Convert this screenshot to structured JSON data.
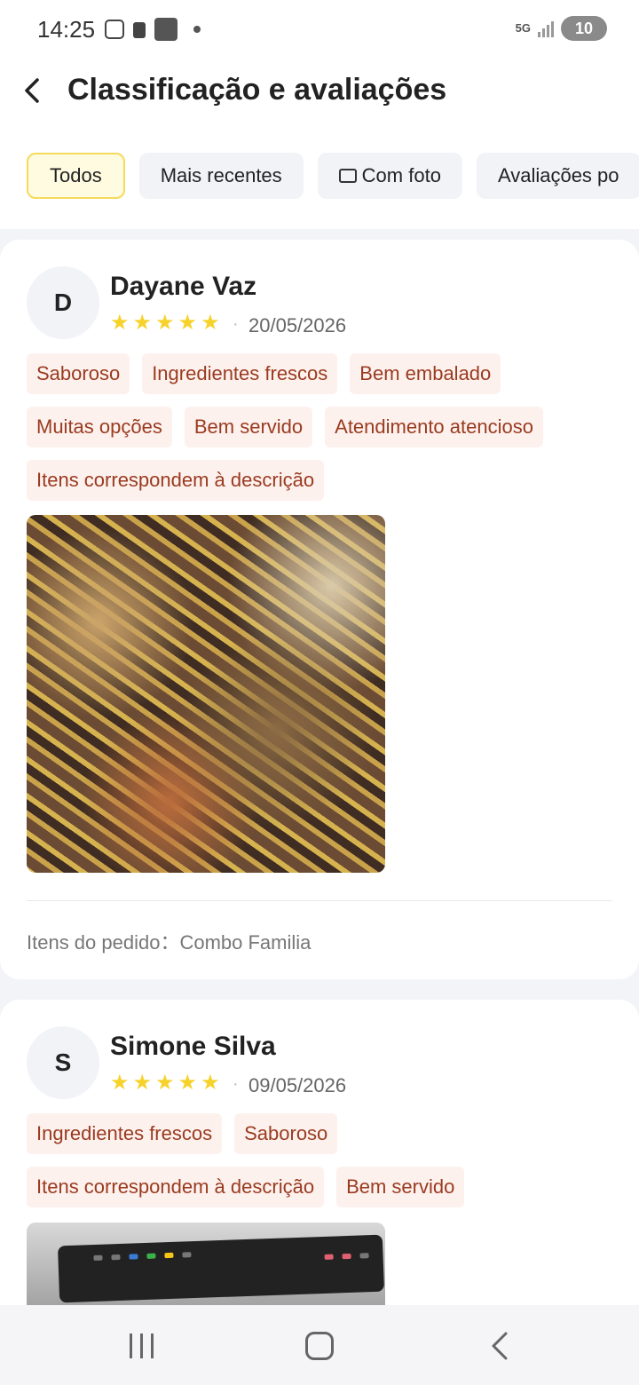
{
  "status_bar": {
    "time": "14:25",
    "network": "5G",
    "battery": "10"
  },
  "header": {
    "title": "Classificação e avaliações",
    "filters": [
      "Todos",
      "Mais recentes",
      "Com foto",
      "Avaliações po"
    ]
  },
  "reviews": [
    {
      "initial": "D",
      "name": "Dayane Vaz",
      "rating": 5,
      "date": "20/05/2026",
      "tags": [
        "Saboroso",
        "Ingredientes frescos",
        "Bem embalado",
        "Muitas opções",
        "Bem servido",
        "Atendimento atencioso",
        "Itens correspondem à descrição"
      ],
      "order_items": "Itens do pedido：Combo Familia"
    },
    {
      "initial": "S",
      "name": "Simone Silva",
      "rating": 5,
      "date": "09/05/2026",
      "tags": [
        "Ingredientes frescos",
        "Saboroso",
        "Itens correspondem à descrição",
        "Bem servido"
      ]
    }
  ],
  "colors": {
    "star": "#f7d22b",
    "tag_bg": "#fdf1ee",
    "tag_text": "#9a3b20",
    "active_chip_border": "#f5db5a"
  }
}
